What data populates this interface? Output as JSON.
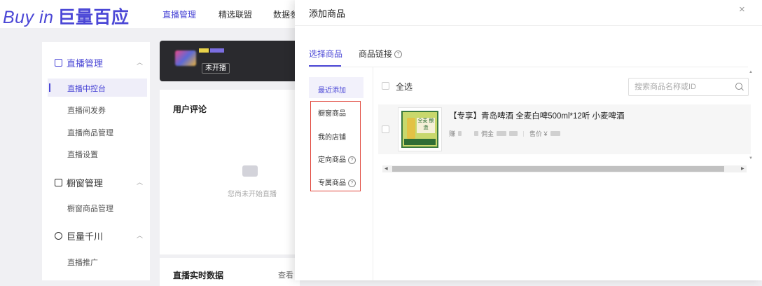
{
  "topbar": {
    "logo_en": "Buy in",
    "logo_cn": "巨量百应",
    "nav": [
      "直播管理",
      "精选联盟",
      "数据参"
    ]
  },
  "sidebar": {
    "groups": [
      {
        "label": "直播管理",
        "items": [
          "直播中控台",
          "直播间发券",
          "直播商品管理",
          "直播设置"
        ]
      },
      {
        "label": "橱窗管理",
        "items": [
          "橱窗商品管理"
        ]
      },
      {
        "label": "巨量千川",
        "items": [
          "直播推广"
        ]
      }
    ]
  },
  "live": {
    "badge": "未开播"
  },
  "comments": {
    "title": "用户评论",
    "empty": "您尚未开始直播"
  },
  "realtime": {
    "title": "直播实时数据",
    "more": "查看"
  },
  "drawer": {
    "title": "添加商品",
    "close": "×",
    "tabs": [
      {
        "label": "选择商品"
      },
      {
        "label": "商品链接",
        "help": "?"
      }
    ],
    "categories": [
      {
        "label": "最近添加"
      },
      {
        "label": "橱窗商品"
      },
      {
        "label": "我的店铺"
      },
      {
        "label": "定向商品",
        "help": "?"
      },
      {
        "label": "专属商品",
        "help": "?"
      }
    ],
    "select_all": "全选",
    "search": {
      "placeholder": "搜索商品名称或ID"
    },
    "product": {
      "title": "【专享】青岛啤酒 全麦白啤500ml*12听 小麦啤酒",
      "meta_prefix": "赚",
      "commission_label": "佣金",
      "price_label": "售价 ¥",
      "thumb_text": "全麦 酿造"
    }
  },
  "colors": {
    "accent": "#4b47d6",
    "highlight_box": "#e0453a"
  }
}
